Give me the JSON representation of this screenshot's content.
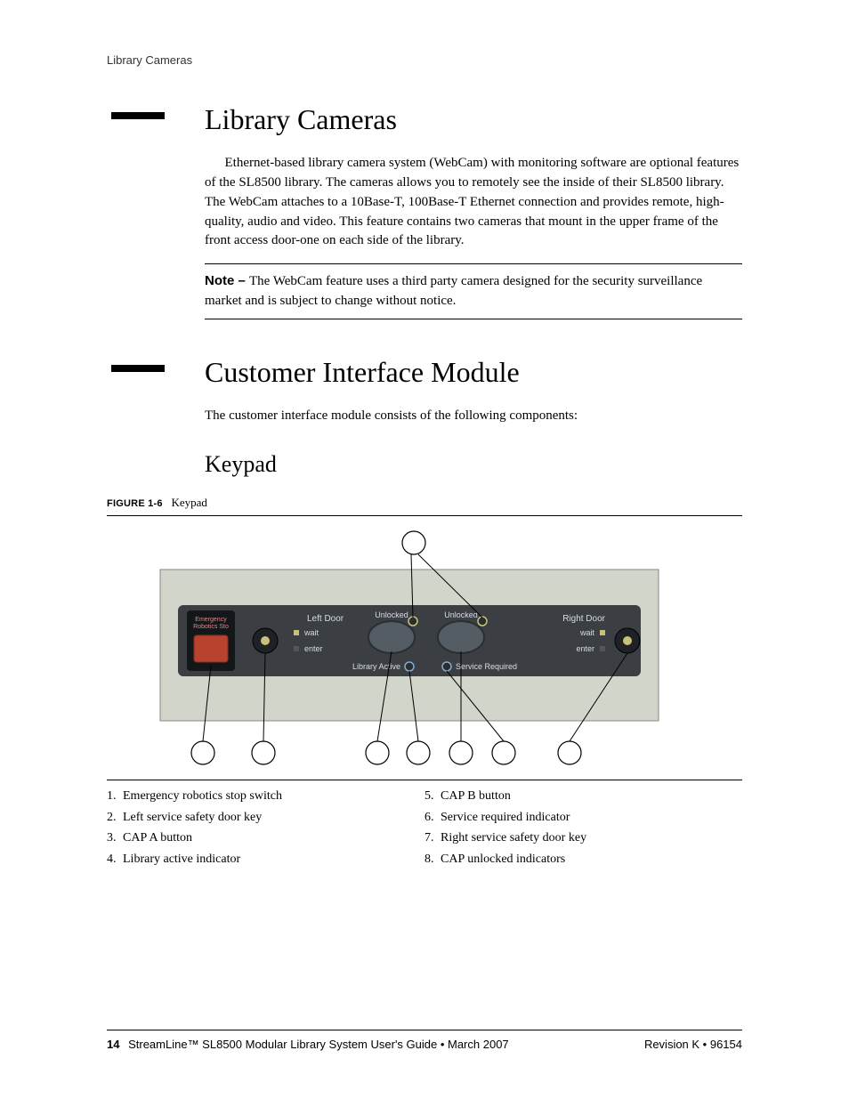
{
  "header": {
    "running": "Library Cameras"
  },
  "section1": {
    "title": "Library Cameras",
    "para1": "Ethernet-based library camera system (WebCam) with monitoring software are optional features of the SL8500 library. The cameras allows you to remotely see the inside of their SL8500 library. The WebCam attaches to a 10Base-T, 100Base-T Ethernet connection and provides remote, high-quality, audio and video. This feature contains two cameras that mount in the upper frame of the front access door-one on each side of the library.",
    "note_label": "Note – ",
    "note_text": "The WebCam feature uses a third party camera designed for the security surveillance market and is subject to change without notice."
  },
  "section2": {
    "title": "Customer Interface Module",
    "intro": "The customer interface module consists of the following components:",
    "sub1": "Keypad",
    "figure_label": "FIGURE 1-6",
    "figure_title": "Keypad",
    "panel": {
      "estop_line1": "Emergency",
      "estop_line2": "Robotics Sto",
      "left_door": "Left Door",
      "right_door": "Right Door",
      "wait_l": "wait",
      "enter_l": "enter",
      "wait_r": "wait",
      "enter_r": "enter",
      "unlocked_a": "Unlocked",
      "unlocked_b": "Unlocked",
      "lib_active": "Library Active",
      "svc_req": "Service Required"
    },
    "legend_left": [
      {
        "n": "1.",
        "t": "Emergency robotics stop switch"
      },
      {
        "n": "2.",
        "t": "Left service safety door key"
      },
      {
        "n": "3.",
        "t": "CAP A button"
      },
      {
        "n": "4.",
        "t": "Library active indicator"
      }
    ],
    "legend_right": [
      {
        "n": "5.",
        "t": "CAP B button"
      },
      {
        "n": "6.",
        "t": "Service required indicator"
      },
      {
        "n": "7.",
        "t": "Right service safety door key"
      },
      {
        "n": "8.",
        "t": "CAP unlocked indicators"
      }
    ]
  },
  "footer": {
    "page": "14",
    "title": "StreamLine™ SL8500 Modular Library System User's Guide  •  March 2007",
    "rev": "Revision K  •  96154"
  }
}
